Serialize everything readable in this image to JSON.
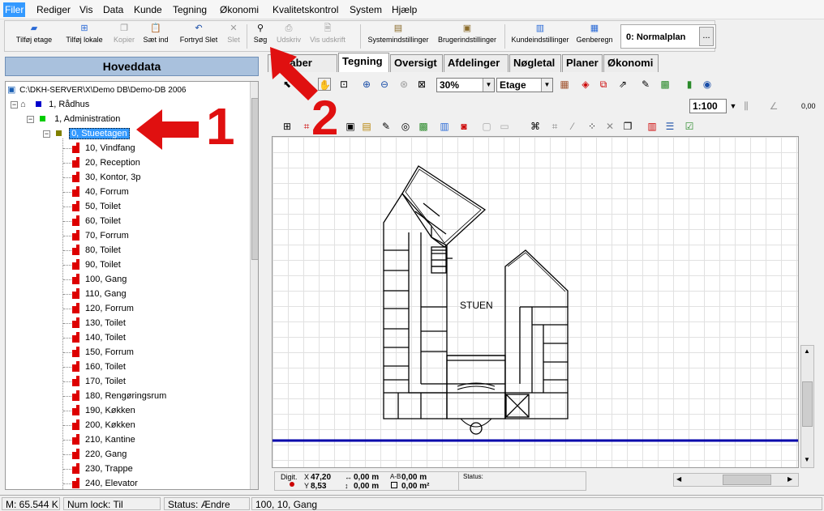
{
  "menu": [
    "Filer",
    "Rediger",
    "Vis",
    "Data",
    "Kunde",
    "Tegning",
    "Økonomi",
    "Kvalitetskontrol",
    "System",
    "Hjælp"
  ],
  "toolbar": {
    "buttons": [
      "Tilføj etage",
      "Tilføj lokale",
      "Kopier",
      "Sæt ind",
      "Fortryd Slet",
      "Slet",
      "Søg",
      "Udskriv",
      "Vis udskrift",
      "Systemindstillinger",
      "Brugerindstillinger",
      "Kundeindstillinger",
      "Genberegn"
    ],
    "plan_value": "0: Normalplan",
    "plan_button": "..."
  },
  "left_panel": {
    "title": "Hoveddata",
    "root": "C:\\DKH-SERVER\\X\\Demo DB\\Demo-DB 2006",
    "building": "1, Rådhus",
    "department": "1, Administration",
    "floor": "0, Stueetagen",
    "rooms": [
      "10, Vindfang",
      "20, Reception",
      "30, Kontor, 3p",
      "40, Forrum",
      "50, Toilet",
      "60, Toilet",
      "70, Forrum",
      "80, Toilet",
      "90, Toilet",
      "100, Gang",
      "110, Gang",
      "120, Forrum",
      "130, Toilet",
      "140, Toilet",
      "150, Forrum",
      "160, Toilet",
      "170, Toilet",
      "180, Rengøringsrum",
      "190, Køkken",
      "200, Køkken",
      "210, Kantine",
      "220, Gang",
      "230, Trappe",
      "240, Elevator"
    ]
  },
  "tabs": [
    "Egenskaber",
    "Tegning",
    "Oversigt",
    "Afdelinger",
    "Nøgletal",
    "Planer",
    "Økonomi"
  ],
  "tab_visible_labels": [
    "nskaber",
    "Tegning",
    "Oversigt",
    "Afdelinger",
    "Nøgletal",
    "Planer",
    "Økonomi"
  ],
  "drawing_toolbar": {
    "zoom": "30%",
    "layer": "Etage",
    "scale": "1:100",
    "small_value": "0,00"
  },
  "drawing": {
    "label": "STUEN"
  },
  "coords": {
    "digit_label": "Digit.",
    "x": "47,20",
    "y": "8,53",
    "dx": "0,00 m",
    "dy": "0,00 m",
    "ab": "0,00 m",
    "area": "0,00 m²",
    "status_label": "Status:"
  },
  "statusbar": {
    "memory": "M: 65.544 K",
    "numlock": "Num lock: Til",
    "status": "Status: Ændre",
    "selection": "100, 10, Gang"
  },
  "annotations": [
    "1",
    "2"
  ],
  "colors": {
    "annotation": "#e01010",
    "selection": "#3399ff",
    "header": "#a9c1dd",
    "wall_line": "#0000aa"
  }
}
